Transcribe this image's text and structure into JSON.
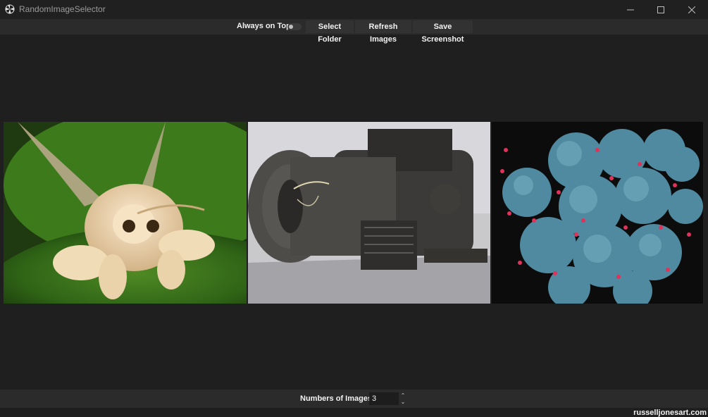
{
  "window": {
    "title": "RandomImageSelector",
    "icon": "pinwheel-icon"
  },
  "toolbar": {
    "always_on_top_label": "Always on Top",
    "always_on_top_enabled": false,
    "select_folder_label": "Select Folder",
    "refresh_label": "Refresh Images",
    "save_screenshot_label": "Save Screenshot"
  },
  "images": [
    {
      "subject": "moth on green leaf"
    },
    {
      "subject": "rusty mechanical engine sculpture"
    },
    {
      "subject": "blue cells with red particles micrograph"
    }
  ],
  "bottom": {
    "count_label": "Numbers of Images",
    "count_value": "3"
  },
  "footer": {
    "credit": "russelljonesart.com"
  },
  "colors": {
    "background": "#1f1f1f",
    "bar": "#2b2b2b",
    "button": "#323232",
    "text": "#f2f2f2"
  }
}
